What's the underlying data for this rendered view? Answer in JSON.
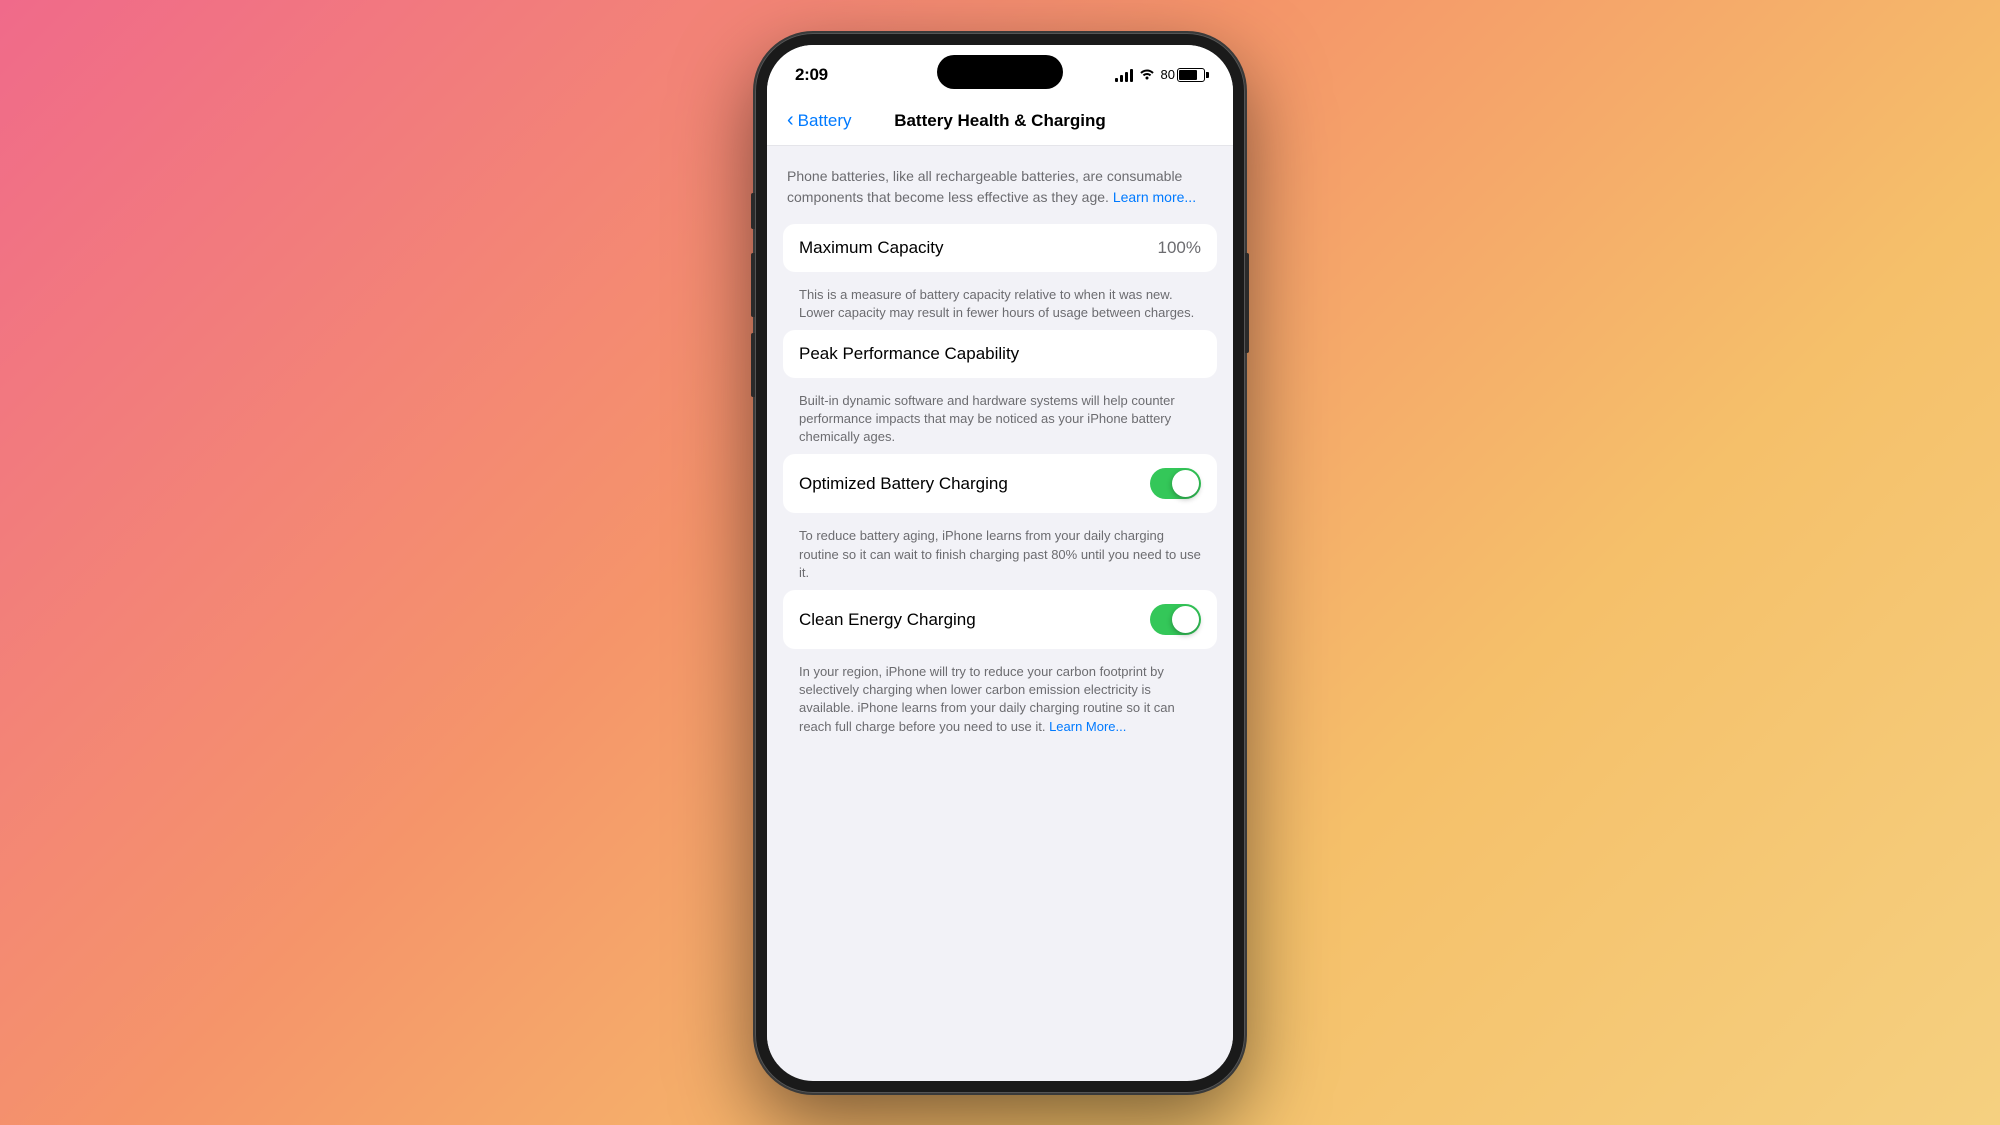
{
  "background": {
    "gradient_start": "#f06a8a",
    "gradient_end": "#f5d080"
  },
  "status_bar": {
    "time": "2:09",
    "battery_percent": "80",
    "battery_label": "80"
  },
  "nav": {
    "back_label": "Battery",
    "title": "Battery Health & Charging"
  },
  "description": {
    "main_text": "Phone batteries, like all rechargeable batteries, are consumable components that become less effective as they age.",
    "learn_more": "Learn more..."
  },
  "maximum_capacity": {
    "label": "Maximum Capacity",
    "value": "100%",
    "description": "This is a measure of battery capacity relative to when it was new. Lower capacity may result in fewer hours of usage between charges."
  },
  "peak_performance": {
    "label": "Peak Performance Capability",
    "description": "Built-in dynamic software and hardware systems will help counter performance impacts that may be noticed as your iPhone battery chemically ages."
  },
  "optimized_charging": {
    "label": "Optimized Battery Charging",
    "toggle_state": "on",
    "description": "To reduce battery aging, iPhone learns from your daily charging routine so it can wait to finish charging past 80% until you need to use it."
  },
  "clean_energy": {
    "label": "Clean Energy Charging",
    "toggle_state": "on",
    "description": "In your region, iPhone will try to reduce your carbon footprint by selectively charging when lower carbon emission electricity is available. iPhone learns from your daily charging routine so it can reach full charge before you need to use it.",
    "learn_more": "Learn More..."
  }
}
